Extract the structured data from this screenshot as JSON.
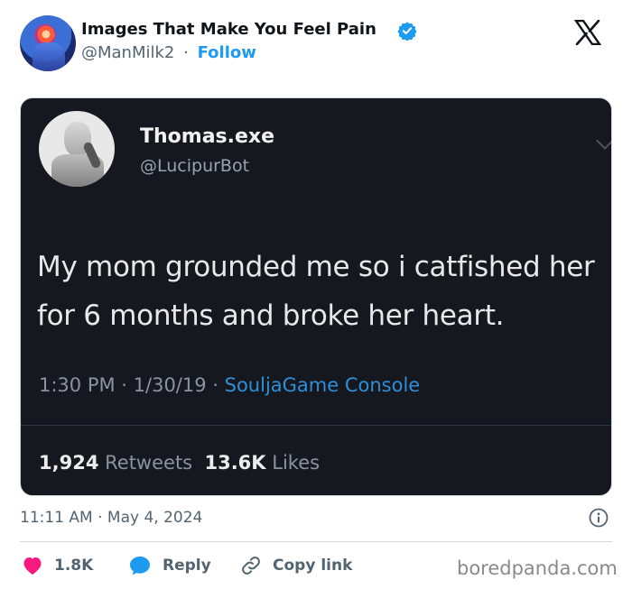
{
  "account": {
    "display_name": "Images That Make You Feel Pain",
    "handle": "@ManMilk2",
    "separator": "·",
    "follow_label": "Follow"
  },
  "embedded_tweet": {
    "display_name": "Thomas.exe",
    "handle": "@LucipurBot",
    "text": "My mom grounded me so i catfished her for 6 months and broke her heart.",
    "time": "1:30 PM · 1/30/19 · ",
    "source": "SouljaGame Console",
    "retweets_count": "1,924",
    "retweets_label": "Retweets",
    "likes_count": "13.6K",
    "likes_label": "Likes"
  },
  "post": {
    "timestamp": "11:11 AM · May 4, 2024"
  },
  "actions": {
    "likes": "1.8K",
    "reply_label": "Reply",
    "copy_link_label": "Copy link"
  },
  "watermark": "boredpanda.com",
  "colors": {
    "accent": "#1d9bf0",
    "heart": "#f91880",
    "text_secondary": "#536471",
    "tweet_bg": "#15181f"
  },
  "icons": [
    "verified-badge-icon",
    "x-logo-icon",
    "info-icon",
    "heart-icon",
    "reply-bubble-icon",
    "link-icon"
  ]
}
